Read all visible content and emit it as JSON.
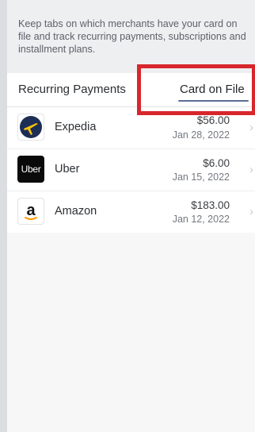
{
  "intro": {
    "text": "Keep tabs on which merchants have your card on file and track recurring payments, subscriptions and installment plans."
  },
  "tabs": [
    {
      "label": "Recurring Payments",
      "active": false
    },
    {
      "label": "Card on File",
      "active": true
    }
  ],
  "merchants": [
    {
      "name": "Expedia",
      "amount": "$56.00",
      "date": "Jan 28, 2022",
      "logo": "expedia-logo"
    },
    {
      "name": "Uber",
      "amount": "$6.00",
      "date": "Jan 15, 2022",
      "logo": "uber-logo",
      "logo_text": "Uber"
    },
    {
      "name": "Amazon",
      "amount": "$183.00",
      "date": "Jan 12, 2022",
      "logo": "amazon-logo",
      "logo_text": "a"
    }
  ],
  "chevron": "›",
  "colors": {
    "highlight": "#d7262c",
    "tab_underline": "#5a6f97",
    "expedia_navy": "#1d2e56",
    "expedia_yellow": "#f4c20d",
    "amazon_orange": "#ff9900"
  }
}
